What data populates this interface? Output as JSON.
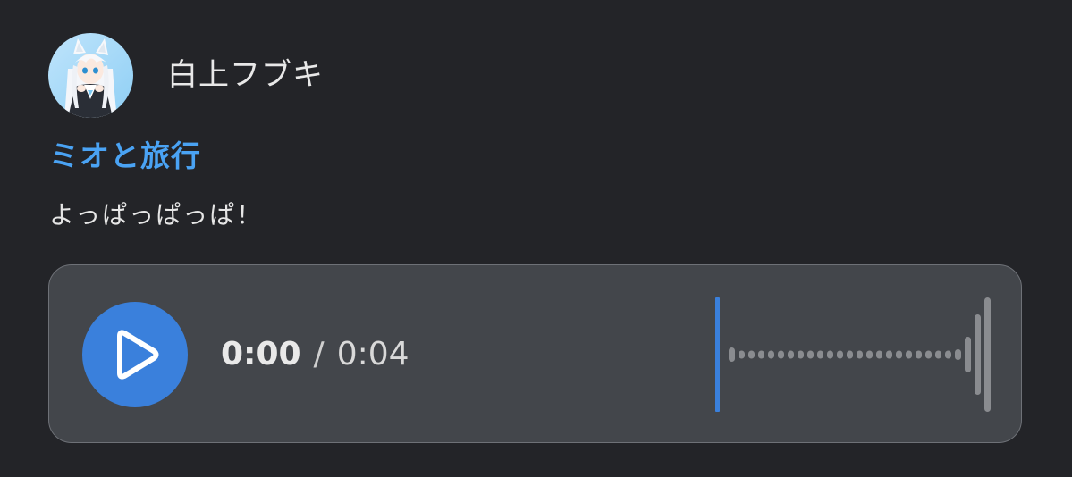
{
  "author": {
    "name": "白上フブキ"
  },
  "post": {
    "title": "ミオと旅行",
    "body": "よっぱっぱっぱ！"
  },
  "player": {
    "current_time": "0:00",
    "separator": "/",
    "total_time": "0:04",
    "progress": 0.0,
    "play_icon": "play-icon",
    "accent_color": "#3a80dc"
  },
  "colors": {
    "background": "#232428",
    "title_link": "#4aa3f4",
    "player_bg": "#43464b"
  }
}
